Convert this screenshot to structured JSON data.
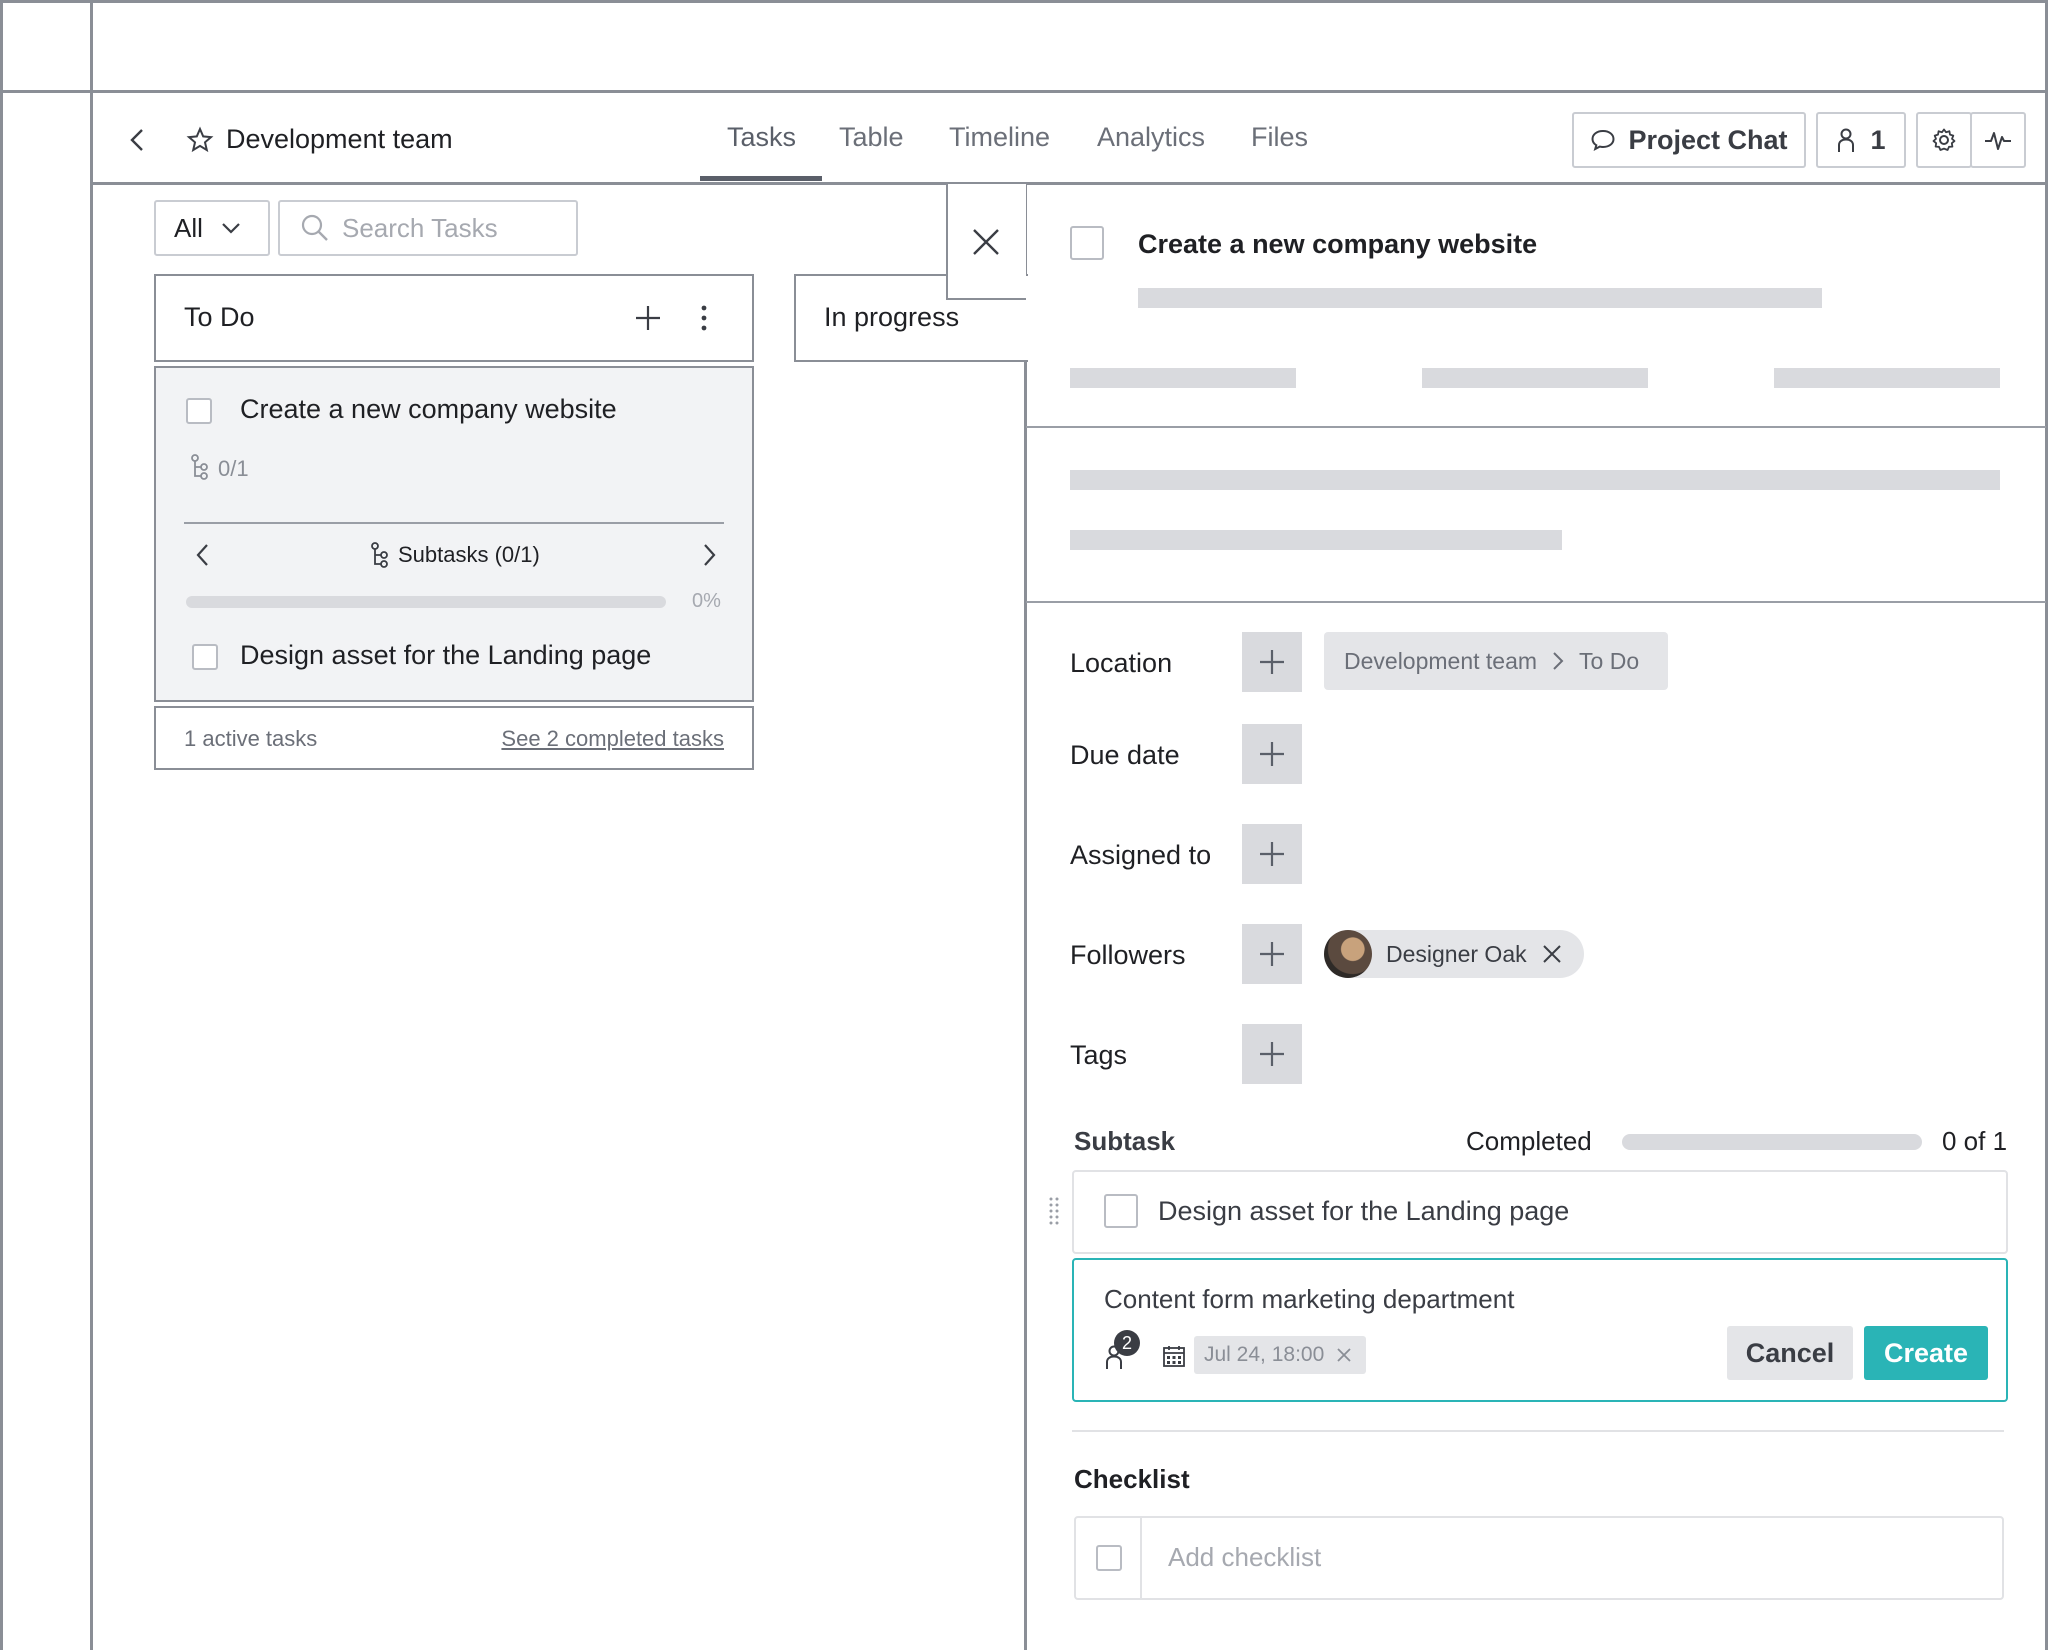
{
  "header": {
    "back_icon": "chevron-left-icon",
    "star_icon": "star-icon",
    "project_title": "Development team",
    "tabs": [
      {
        "label": "Tasks",
        "active": true
      },
      {
        "label": "Table",
        "active": false
      },
      {
        "label": "Timeline",
        "active": false
      },
      {
        "label": "Analytics",
        "active": false
      },
      {
        "label": "Files",
        "active": false
      }
    ],
    "project_chat_label": "Project Chat",
    "members_count": "1",
    "settings_icon": "gear-icon",
    "activity_icon": "pulse-icon"
  },
  "toolbar": {
    "filter_value": "All",
    "search_placeholder": "Search Tasks"
  },
  "columns": [
    {
      "title": "To Do",
      "card": {
        "title": "Create a new company website",
        "subtask_count": "0/1",
        "subtasks_label": "Subtasks (0/1)",
        "progress_label": "0%",
        "progress": 0,
        "subtask_item": "Design asset for the Landing page"
      },
      "footer": {
        "active": "1 active tasks",
        "completed_link": "See 2 completed tasks"
      }
    },
    {
      "title": "In progress"
    }
  ],
  "detail": {
    "title": "Create a new company website",
    "fields": {
      "location_label": "Location",
      "location_project": "Development team",
      "location_list": "To Do",
      "due_label": "Due date",
      "assigned_label": "Assigned to",
      "followers_label": "Followers",
      "follower_name": "Designer Oak",
      "tags_label": "Tags"
    },
    "subtask": {
      "heading": "Subtask",
      "completed_label": "Completed",
      "completed_count": "0 of 1",
      "progress": 0,
      "item": "Design asset for the Landing page",
      "new_item_text": "Content form marketing department",
      "assignee_badge": "2",
      "due_chip": "Jul 24, 18:00",
      "cancel_label": "Cancel",
      "create_label": "Create"
    },
    "checklist": {
      "heading": "Checklist",
      "placeholder": "Add checklist"
    }
  },
  "colors": {
    "accent": "#2ab4b6",
    "placeholder_bar": "#d9dade",
    "border": "#8a8e96"
  }
}
